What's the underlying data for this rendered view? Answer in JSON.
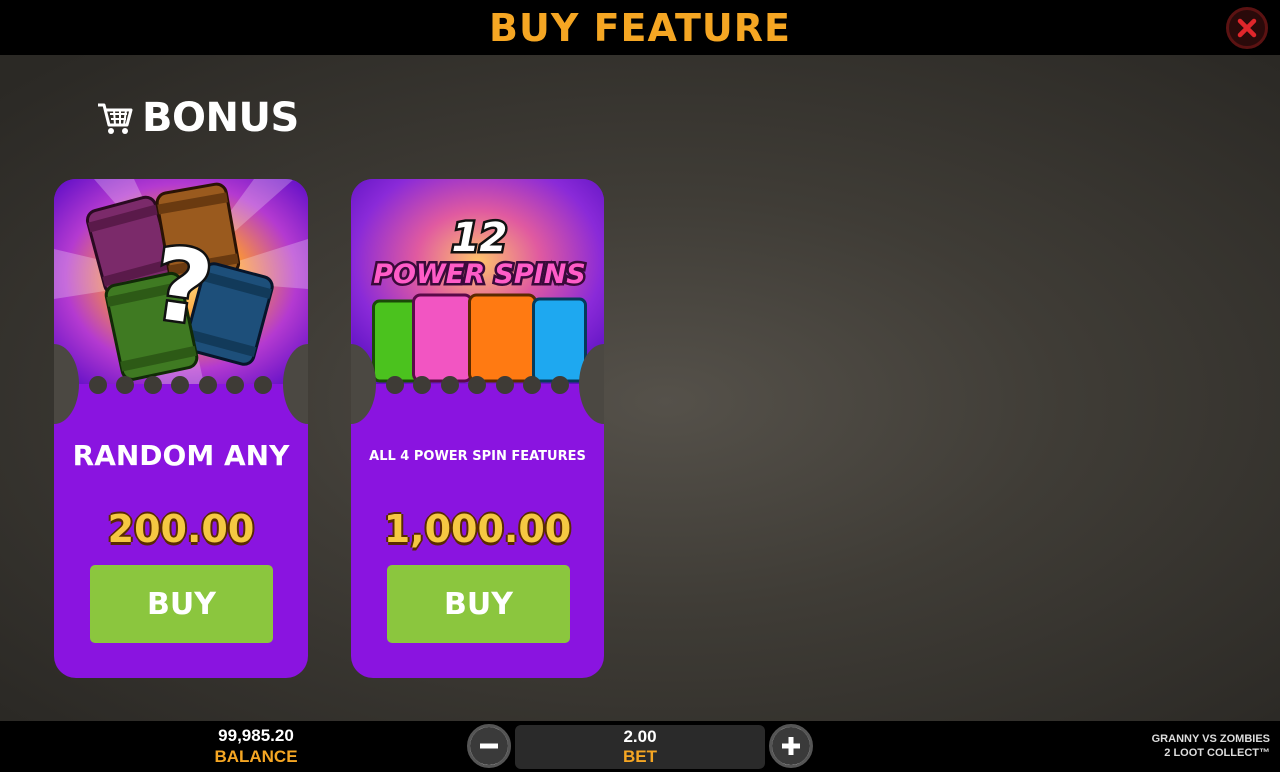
{
  "header": {
    "title": "BUY FEATURE"
  },
  "section": {
    "label": "BONUS"
  },
  "cards": [
    {
      "name": "RANDOM ANY",
      "price": "200.00",
      "buy_label": "BUY"
    },
    {
      "art_count": "12",
      "art_title": "POWER SPINS",
      "name": "ALL 4 POWER SPIN FEATURES",
      "price": "1,000.00",
      "buy_label": "BUY"
    }
  ],
  "footer": {
    "balance_value": "99,985.20",
    "balance_label": "BALANCE",
    "bet_value": "2.00",
    "bet_label": "BET",
    "game_line1": "GRANNY VS ZOMBIES",
    "game_line2": "2 LOOT COLLECT™"
  },
  "colors": {
    "accent": "#f5a623",
    "card": "#8a14e0",
    "buy": "#8bc63e",
    "price": "#f5c842"
  },
  "icons": [
    "close-icon",
    "cart-icon",
    "minus-icon",
    "plus-icon"
  ]
}
